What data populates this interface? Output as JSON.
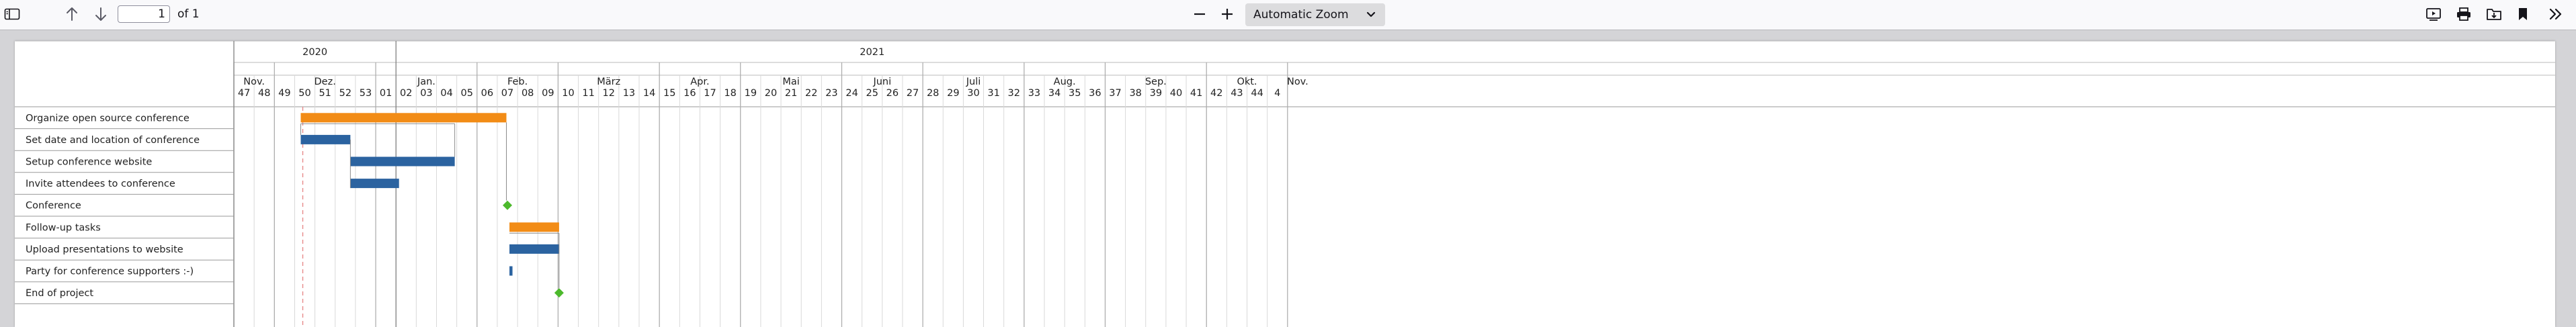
{
  "toolbar": {
    "sidebar_toggle_icon": "sidebar-icon",
    "prev_icon": "arrow-up-icon",
    "next_icon": "arrow-down-icon",
    "page_number": "1",
    "page_count_label": "of 1",
    "zoom_out_icon": "minus-icon",
    "zoom_in_icon": "plus-icon",
    "zoom_value": "Automatic Zoom",
    "presentation_icon": "presentation-icon",
    "print_icon": "print-icon",
    "save_icon": "save-icon",
    "bookmark_icon": "bookmark-icon",
    "tools_icon": "double-chevron-right-icon"
  },
  "chart_data": {
    "type": "gantt",
    "years": [
      {
        "label": "2020",
        "weeks": 8
      },
      {
        "label": "2021",
        "weeks": 47
      }
    ],
    "months": [
      {
        "label": "Nov.",
        "weeks": 2
      },
      {
        "label": "Dez.",
        "weeks": 5
      },
      {
        "label": "Jan.",
        "weeks": 5
      },
      {
        "label": "Feb.",
        "weeks": 4
      },
      {
        "label": "März",
        "weeks": 5
      },
      {
        "label": "Apr.",
        "weeks": 4
      },
      {
        "label": "Mai",
        "weeks": 5
      },
      {
        "label": "Juni",
        "weeks": 4
      },
      {
        "label": "Juli",
        "weeks": 5
      },
      {
        "label": "Aug.",
        "weeks": 4
      },
      {
        "label": "Sep.",
        "weeks": 5
      },
      {
        "label": "Okt.",
        "weeks": 4
      },
      {
        "label": "Nov.",
        "weeks": 1
      }
    ],
    "weeks": [
      "47",
      "48",
      "49",
      "50",
      "51",
      "52",
      "53",
      "01",
      "02",
      "03",
      "04",
      "05",
      "06",
      "07",
      "08",
      "09",
      "10",
      "11",
      "12",
      "13",
      "14",
      "15",
      "16",
      "17",
      "18",
      "19",
      "20",
      "21",
      "22",
      "23",
      "24",
      "25",
      "26",
      "27",
      "28",
      "29",
      "30",
      "31",
      "32",
      "33",
      "34",
      "35",
      "36",
      "37",
      "38",
      "39",
      "40",
      "41",
      "42",
      "43",
      "44",
      "4"
    ],
    "today_marker_week": 3.4,
    "colors": {
      "summary": "#f28c16",
      "task": "#2b63a0",
      "milestone": "#4cb92c",
      "grid": "#d9d9d9",
      "month_line": "#aaaaaa",
      "today": "#e88a8a",
      "link": "#8a8a8a"
    },
    "tasks": [
      {
        "name": "Organize open source conference",
        "type": "summary",
        "start": 3.3,
        "end": 13.45
      },
      {
        "name": "Set date and location of conference",
        "type": "task",
        "start": 3.3,
        "end": 5.75
      },
      {
        "name": "Setup conference website",
        "type": "task",
        "start": 5.75,
        "end": 10.9
      },
      {
        "name": "Invite attendees to conference",
        "type": "task",
        "start": 5.75,
        "end": 8.15
      },
      {
        "name": "Conference",
        "type": "milestone",
        "start": 13.5,
        "end": 13.5
      },
      {
        "name": "Follow-up tasks",
        "type": "summary",
        "start": 13.6,
        "end": 16.05
      },
      {
        "name": "Upload presentations to website",
        "type": "task",
        "start": 13.6,
        "end": 16.05
      },
      {
        "name": "Party for conference supporters :-)",
        "type": "task",
        "start": 13.6,
        "end": 13.75
      },
      {
        "name": "End of project",
        "type": "milestone",
        "start": 16.05,
        "end": 16.05
      }
    ]
  }
}
